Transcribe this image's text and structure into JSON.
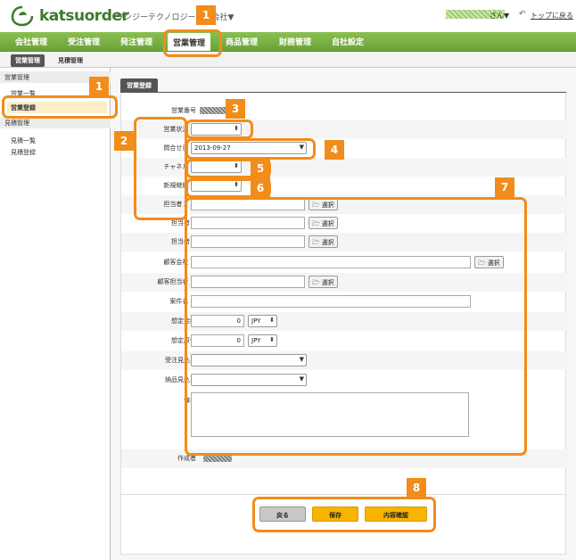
{
  "header": {
    "brand": "katsuorder",
    "company": "ワンジーテクノロジー株式会社▼",
    "user_suffix": "さん▼",
    "back_to_top": "トップに戻る"
  },
  "nav": {
    "items": [
      "会社管理",
      "受注管理",
      "発注管理",
      "営業管理",
      "商品管理",
      "財務管理",
      "自社設定"
    ],
    "active": "営業管理"
  },
  "subnav": {
    "items": [
      "営業管理",
      "見積管理"
    ],
    "active": "営業管理"
  },
  "sidebar": {
    "section1": "営業管理",
    "item1": "営業一覧",
    "item2": "営業登録",
    "section2": "見積管理",
    "item3": "見積一覧",
    "item4": "見積登録"
  },
  "main": {
    "tab": "営業登録",
    "required_mark": "■",
    "pick_label": "選択",
    "labels": {
      "number": "営業番号",
      "status": "営業状況",
      "inquiry_date": "問合せ日",
      "channel": "チャネル",
      "new_or_cont": "新規継続",
      "staff1": "担当者１",
      "staff2": "担当者２",
      "staff3": "担当者３",
      "client": "顧客会社",
      "client_staff": "顧客担当者",
      "case_name": "案件名",
      "est_amount": "想定金額",
      "est_cost": "想定原価",
      "order_date": "受注見込日",
      "delivery_date": "納品見込日",
      "notes": "備考",
      "creator": "作成者"
    },
    "values": {
      "inquiry_date": "2013-09-27",
      "est_amount": "0",
      "est_cost": "0",
      "currency": "JPY"
    },
    "buttons": {
      "back": "戻る",
      "save": "保存",
      "confirm": "内容確認"
    }
  },
  "annotations": [
    "1",
    "1",
    "2",
    "3",
    "4",
    "5",
    "6",
    "7",
    "8"
  ],
  "colors": {
    "accent": "#f28c1a",
    "nav_green": "#6aa238",
    "save_button": "#f8b400"
  }
}
